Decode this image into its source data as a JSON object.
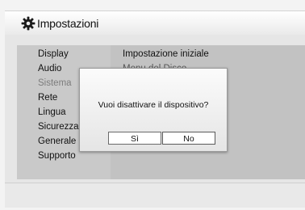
{
  "header": {
    "title": "Impostazioni",
    "icon": "gear-icon"
  },
  "menu": {
    "items": [
      {
        "label": "Display",
        "dimmed": false
      },
      {
        "label": "Audio",
        "dimmed": false
      },
      {
        "label": "Sistema",
        "dimmed": true
      },
      {
        "label": "Rete",
        "dimmed": false
      },
      {
        "label": "Lingua",
        "dimmed": false
      },
      {
        "label": "Sicurezza",
        "dimmed": false
      },
      {
        "label": "Generale",
        "dimmed": false
      },
      {
        "label": "Supporto",
        "dimmed": false
      }
    ]
  },
  "submenu": {
    "items": [
      {
        "label": "Impostazione iniziale"
      },
      {
        "label": "Menu del Disco"
      }
    ]
  },
  "dialog": {
    "message": "Vuoi disattivare il dispositivo?",
    "yes_label": "Sì",
    "no_label": "No",
    "selected": "no"
  },
  "colors": {
    "selected_border": "#5a5a5a",
    "dimmed_text": "#7c7c7c"
  }
}
